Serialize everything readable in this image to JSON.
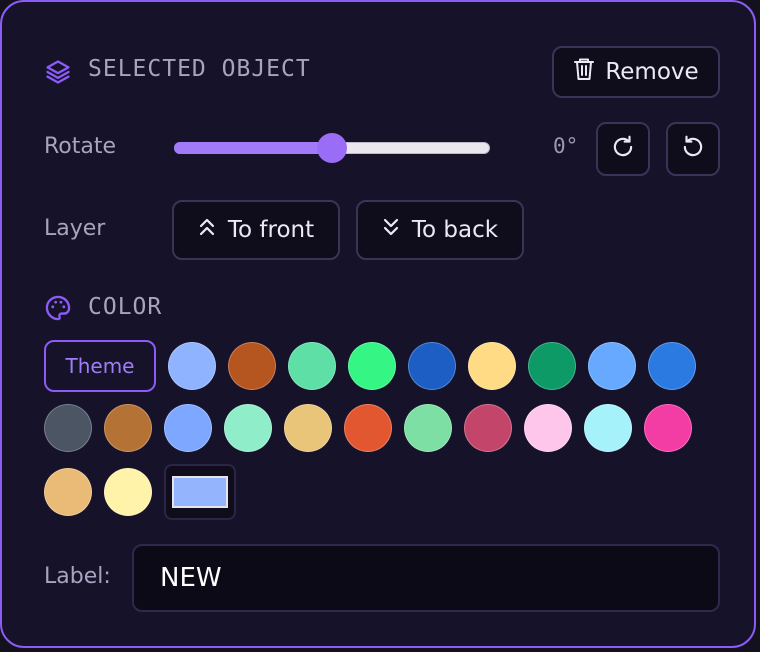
{
  "header": {
    "title": "SELECTED OBJECT",
    "remove_label": "Remove"
  },
  "rotate": {
    "label": "Rotate",
    "value_text": "0°",
    "slider_fraction": 0.5
  },
  "layer": {
    "label": "Layer",
    "to_front_label": "To front",
    "to_back_label": "To back"
  },
  "color": {
    "title": "COLOR",
    "theme_label": "Theme",
    "swatches": [
      "#8fb3ff",
      "#b55520",
      "#5ddfa6",
      "#35f584",
      "#1c5ec4",
      "#fedb84",
      "#0d9a66",
      "#66a9ff",
      "#2a7ae2",
      "#4b5563",
      "#b57235",
      "#7ea8ff",
      "#8fedc9",
      "#e8c579",
      "#e25630",
      "#7ddfa3",
      "#c3456a",
      "#fec6ea",
      "#a6f2fa",
      "#f43da4",
      "#eabb76",
      "#fff2a9"
    ],
    "custom_color": "#94b5fd",
    "accent": "#8b5cf6"
  },
  "label_field": {
    "label": "Label:",
    "value": "NEW"
  }
}
